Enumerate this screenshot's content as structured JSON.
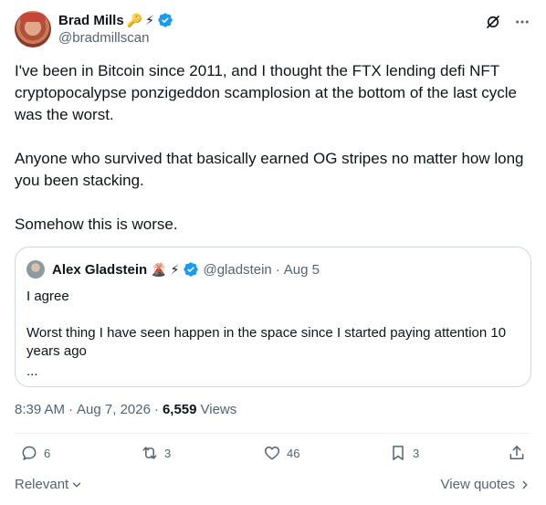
{
  "author": {
    "name": "Brad Mills",
    "handle": "@bradmillscan",
    "name_emojis": [
      "🔑",
      "⚡"
    ],
    "avatar_icon": "avatar-photo"
  },
  "header_actions": [
    "grok-icon",
    "more-icon"
  ],
  "tweet": {
    "paragraphs": [
      "I've been in Bitcoin since 2011, and I thought the FTX lending defi NFT cryptopocalypse ponzigeddon scamplosion at the bottom of the last cycle was the worst.",
      "Anyone who survived that basically earned OG stripes no matter how long you been stacking.",
      "Somehow this is worse."
    ]
  },
  "quote": {
    "name": "Alex Gladstein",
    "name_emojis": [
      "🌋",
      "⚡"
    ],
    "handle": "@gladstein",
    "separator": "·",
    "date": "Aug 5",
    "lines": [
      "I agree",
      "Worst thing I have seen happen in the space since I started paying attention 10 years ago",
      "..."
    ]
  },
  "meta": {
    "time": "8:39 AM",
    "dot1": "·",
    "date": "Aug 7, 2026",
    "dot2": "·",
    "views": "6,559",
    "views_label": "Views"
  },
  "actions": {
    "replies": "6",
    "reposts": "3",
    "likes": "46",
    "bookmarks": "3"
  },
  "footer": {
    "sort_label": "Relevant",
    "view_quotes_label": "View quotes"
  },
  "colors": {
    "text": "#0f1419",
    "muted": "#536471",
    "verified": "#1d9bf0",
    "border": "#cfd9de",
    "divider": "#eff3f4"
  }
}
